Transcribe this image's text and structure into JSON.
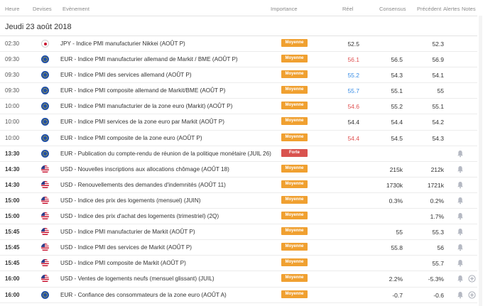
{
  "header": {
    "heure": "Heure",
    "devises": "Devises",
    "evenement": "Evènement",
    "importance": "Importance",
    "reel": "Réel",
    "consensus": "Consensus",
    "precedent": "Précédent",
    "alertes": "Alertes",
    "notes": "Notes"
  },
  "date": "Jeudi 23 août 2018",
  "colors": {
    "medium": "#f0a030",
    "high": "#d9534f",
    "up": "#3a8ee6",
    "down": "#e05252"
  },
  "rows": [
    {
      "time": "02:30",
      "bold": false,
      "flag": "jp",
      "event": "JPY - Indice PMI manufacturier Nikkei (AOÛT P)",
      "importance": "Moyenne",
      "level": "med",
      "actual": "52.5",
      "actual_color": "neutral",
      "consensus": "",
      "previous": "52.3",
      "alert": false,
      "note": false
    },
    {
      "time": "09:30",
      "bold": false,
      "flag": "eu",
      "event": "EUR - Indice PMI manufacturier allemand de Markit / BME (AOÛT P)",
      "importance": "Moyenne",
      "level": "med",
      "actual": "56.1",
      "actual_color": "down",
      "consensus": "56.5",
      "previous": "56.9",
      "alert": false,
      "note": false
    },
    {
      "time": "09:30",
      "bold": false,
      "flag": "eu",
      "event": "EUR - Indice PMI des services allemand (AOÛT P)",
      "importance": "Moyenne",
      "level": "med",
      "actual": "55.2",
      "actual_color": "up",
      "consensus": "54.3",
      "previous": "54.1",
      "alert": false,
      "note": false
    },
    {
      "time": "09:30",
      "bold": false,
      "flag": "eu",
      "event": "EUR - Indice PMI composite allemand de Markit/BME (AOÛT P)",
      "importance": "Moyenne",
      "level": "med",
      "actual": "55.7",
      "actual_color": "up",
      "consensus": "55.1",
      "previous": "55",
      "alert": false,
      "note": false
    },
    {
      "time": "10:00",
      "bold": false,
      "flag": "eu",
      "event": "EUR - Indice PMI manufacturier de la zone euro (Markit) (AOÛT P)",
      "importance": "Moyenne",
      "level": "med",
      "actual": "54.6",
      "actual_color": "down",
      "consensus": "55.2",
      "previous": "55.1",
      "alert": false,
      "note": false
    },
    {
      "time": "10:00",
      "bold": false,
      "flag": "eu",
      "event": "EUR - Indice PMI services de la zone euro par Markit (AOÛT P)",
      "importance": "Moyenne",
      "level": "med",
      "actual": "54.4",
      "actual_color": "neutral",
      "consensus": "54.4",
      "previous": "54.2",
      "alert": false,
      "note": false
    },
    {
      "time": "10:00",
      "bold": false,
      "flag": "eu",
      "event": "EUR - Indice PMI composite de la zone euro (AOÛT P)",
      "importance": "Moyenne",
      "level": "med",
      "actual": "54.4",
      "actual_color": "down",
      "consensus": "54.5",
      "previous": "54.3",
      "alert": false,
      "note": false
    },
    {
      "time": "13:30",
      "bold": true,
      "flag": "eu",
      "event": "EUR - Publication du compte-rendu de réunion de la politique monétaire (JUIL 26)",
      "importance": "Forte",
      "level": "high",
      "actual": "",
      "actual_color": "neutral",
      "consensus": "",
      "previous": "",
      "alert": true,
      "note": false
    },
    {
      "time": "14:30",
      "bold": true,
      "flag": "us",
      "event": "USD - Nouvelles inscriptions aux allocations chômage (AOÛT 18)",
      "importance": "Moyenne",
      "level": "med",
      "actual": "",
      "actual_color": "neutral",
      "consensus": "215k",
      "previous": "212k",
      "alert": true,
      "note": false
    },
    {
      "time": "14:30",
      "bold": true,
      "flag": "us",
      "event": "USD - Renouvellements des demandes d'indemnités (AOÛT 11)",
      "importance": "Moyenne",
      "level": "med",
      "actual": "",
      "actual_color": "neutral",
      "consensus": "1730k",
      "previous": "1721k",
      "alert": true,
      "note": false
    },
    {
      "time": "15:00",
      "bold": true,
      "flag": "us",
      "event": "USD - Indice des prix des logements (mensuel) (JUIN)",
      "importance": "Moyenne",
      "level": "med",
      "actual": "",
      "actual_color": "neutral",
      "consensus": "0.3%",
      "previous": "0.2%",
      "alert": true,
      "note": false
    },
    {
      "time": "15:00",
      "bold": true,
      "flag": "us",
      "event": "USD - Indice des prix d'achat des logements (trimestriel) (2Q)",
      "importance": "Moyenne",
      "level": "med",
      "actual": "",
      "actual_color": "neutral",
      "consensus": "",
      "previous": "1.7%",
      "alert": true,
      "note": false
    },
    {
      "time": "15:45",
      "bold": true,
      "flag": "us",
      "event": "USD - Indice PMI manufacturier de Markit (AOÛT P)",
      "importance": "Moyenne",
      "level": "med",
      "actual": "",
      "actual_color": "neutral",
      "consensus": "55",
      "previous": "55.3",
      "alert": true,
      "note": false
    },
    {
      "time": "15:45",
      "bold": true,
      "flag": "us",
      "event": "USD - Indice PMI des services de Markit (AOÛT P)",
      "importance": "Moyenne",
      "level": "med",
      "actual": "",
      "actual_color": "neutral",
      "consensus": "55.8",
      "previous": "56",
      "alert": true,
      "note": false
    },
    {
      "time": "15:45",
      "bold": true,
      "flag": "us",
      "event": "USD - Indice PMI composite de Markit (AOÛT P)",
      "importance": "Moyenne",
      "level": "med",
      "actual": "",
      "actual_color": "neutral",
      "consensus": "",
      "previous": "55.7",
      "alert": true,
      "note": false
    },
    {
      "time": "16:00",
      "bold": true,
      "flag": "us",
      "event": "USD - Ventes de logements neufs (mensuel glissant) (JUIL)",
      "importance": "Moyenne",
      "level": "med",
      "actual": "",
      "actual_color": "neutral",
      "consensus": "2.2%",
      "previous": "-5.3%",
      "alert": true,
      "note": true
    },
    {
      "time": "16:00",
      "bold": true,
      "flag": "eu",
      "event": "EUR - Confiance des consommateurs de la zone euro (AOÛT A)",
      "importance": "Moyenne",
      "level": "med",
      "actual": "",
      "actual_color": "neutral",
      "consensus": "-0.7",
      "previous": "-0.6",
      "alert": true,
      "note": true
    }
  ]
}
